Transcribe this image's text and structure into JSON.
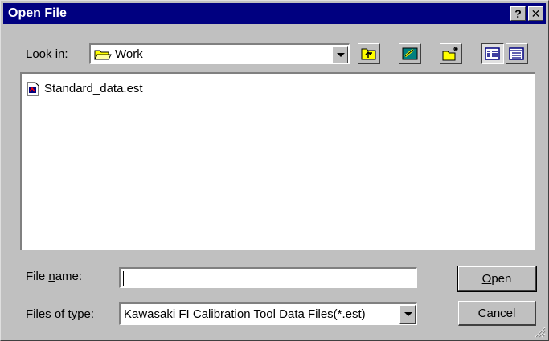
{
  "dialog": {
    "title": "Open File",
    "help_label": "?",
    "close_label": "✕"
  },
  "lookin": {
    "label_pre": "Look ",
    "label_accel": "i",
    "label_post": "n:",
    "value": "Work"
  },
  "toolbar": {
    "icons": [
      "up-one-level-icon",
      "desktop-icon",
      "create-new-folder-icon",
      "list-view-icon",
      "details-view-icon"
    ]
  },
  "files": [
    {
      "name": "Standard_data.est",
      "icon": "data-file-icon"
    }
  ],
  "filename": {
    "label_pre": "File ",
    "label_accel": "n",
    "label_post": "ame:",
    "value": ""
  },
  "filetype": {
    "label_pre": "Files of ",
    "label_accel": "t",
    "label_post": "ype:",
    "value": "Kawasaki FI Calibration Tool Data Files(*.est)"
  },
  "buttons": {
    "open_accel": "O",
    "open_rest": "pen",
    "cancel": "Cancel"
  },
  "colors": {
    "titlebar": "#000080",
    "face": "#c0c0c0",
    "folder": "#ffff00"
  }
}
